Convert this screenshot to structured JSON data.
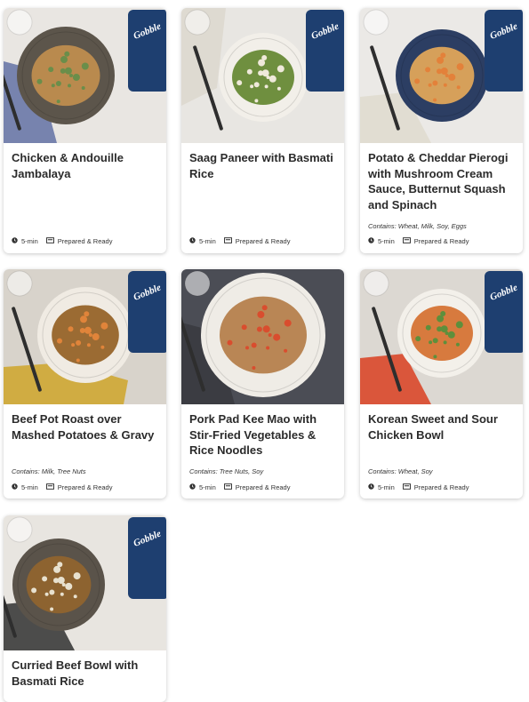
{
  "meals": [
    {
      "title": "Chicken & Andouille Jambalaya",
      "contains": "",
      "time": "5-min",
      "prep": "Prepared & Ready",
      "box_label": "Gobble",
      "colors": {
        "bg": "#e9e6e2",
        "plate": "#5c554b",
        "food": "#b98a4e",
        "garnish": "#6a8e4a",
        "cloth": "#6a78a8"
      }
    },
    {
      "title": "Saag Paneer with Basmati Rice",
      "contains": "",
      "time": "5-min",
      "prep": "Prepared & Ready",
      "box_label": "Gobble",
      "colors": {
        "bg": "#e8e6e2",
        "plate": "#f2efe9",
        "food": "#6f8f3f",
        "garnish": "#efe9da",
        "cloth": "#ddd8cf"
      }
    },
    {
      "title": "Potato & Cheddar Pierogi with Mushroom Cream Sauce, Butternut Squash and Spinach",
      "contains": "Contains: Wheat, Milk, Soy, Eggs",
      "time": "5-min",
      "prep": "Prepared & Ready",
      "box_label": "Gobble",
      "colors": {
        "bg": "#ebe9e6",
        "plate": "#2c3e63",
        "food": "#d6a05a",
        "garnish": "#e3813a",
        "cloth": "#e0dbcf"
      }
    },
    {
      "title": "Beef Pot Roast over Mashed Potatoes & Gravy",
      "contains": "Contains: Milk, Tree Nuts",
      "time": "5-min",
      "prep": "Prepared & Ready",
      "box_label": "Gobble",
      "colors": {
        "bg": "#d8d3cb",
        "plate": "#f0ebe3",
        "food": "#9b6b33",
        "garnish": "#e0843a",
        "cloth": "#cfa733"
      }
    },
    {
      "title": "Pork Pad Kee Mao with Stir-Fried Vegetables & Rice Noodles",
      "contains": "Contains: Tree Nuts, Soy",
      "time": "5-min",
      "prep": "Prepared & Ready",
      "box_label": "",
      "colors": {
        "bg": "#4b4d55",
        "plate": "#efece6",
        "food": "#b98655",
        "garnish": "#d94d2e",
        "cloth": "#3a3b40"
      }
    },
    {
      "title": "Korean Sweet and Sour Chicken Bowl",
      "contains": "Contains: Wheat, Soy",
      "time": "5-min",
      "prep": "Prepared & Ready",
      "box_label": "Gobble",
      "colors": {
        "bg": "#dcd8d2",
        "plate": "#f3f0ea",
        "food": "#d77a3e",
        "garnish": "#5e8f3c",
        "cloth": "#d9482a"
      }
    },
    {
      "title": "Curried Beef Bowl with Basmati Rice",
      "contains": "",
      "time": "",
      "prep": "",
      "box_label": "Gobble",
      "colors": {
        "bg": "#e8e5e0",
        "plate": "#5a534a",
        "food": "#8d6330",
        "garnish": "#e8e1cf",
        "cloth": "#3b3b3b"
      }
    }
  ]
}
